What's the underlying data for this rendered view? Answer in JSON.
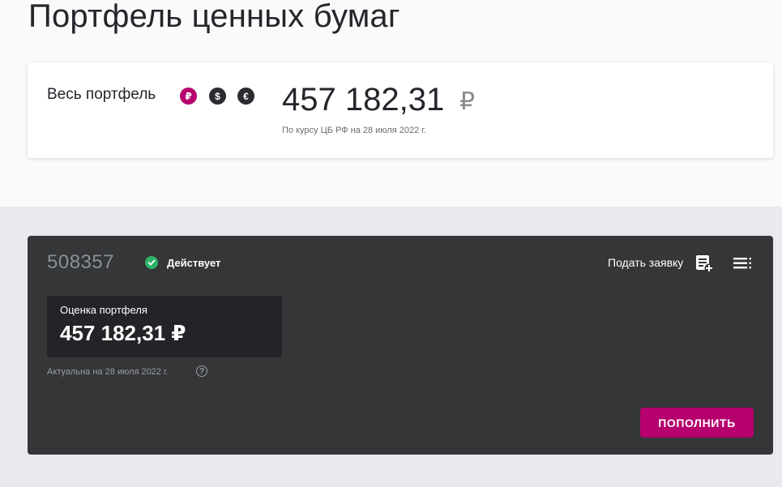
{
  "page": {
    "title": "Портфель ценных бумаг"
  },
  "summary": {
    "label": "Весь портфель",
    "currencies": [
      {
        "symbol": "₽",
        "icon": "ruble-icon",
        "color": "#b5006e",
        "selected": true
      },
      {
        "symbol": "$",
        "icon": "dollar-icon",
        "color": "#2a2c2f",
        "selected": false
      },
      {
        "symbol": "€",
        "icon": "euro-icon",
        "color": "#2a2c2f",
        "selected": false
      }
    ],
    "value": "457 182,31",
    "currency_sign": "₽",
    "rate_note": "По курсу ЦБ РФ на 28 июля 2022 г."
  },
  "account": {
    "number": "508357",
    "status": "Действует",
    "status_color": "#2fb36b",
    "request_label": "Подать заявку",
    "valuation_label": "Оценка портфеля",
    "valuation_value": "457 182,31 ₽",
    "actual_note": "Актуальна на 28 июля 2022 г.",
    "help_symbol": "?",
    "topup_label": "ПОПОЛНИТЬ",
    "accent_color": "#b5006e"
  }
}
